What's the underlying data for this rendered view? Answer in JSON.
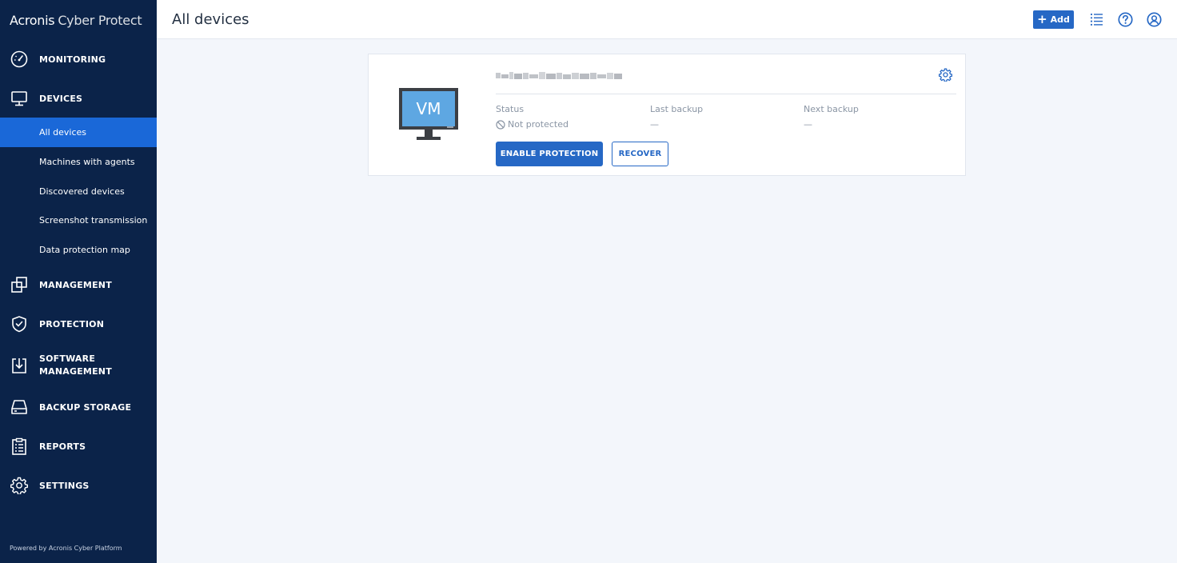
{
  "brand": {
    "part1": "Acronis",
    "part2": "Cyber Protect"
  },
  "sidebar": {
    "items": [
      {
        "label": "MONITORING"
      },
      {
        "label": "DEVICES"
      },
      {
        "label": "MANAGEMENT"
      },
      {
        "label": "PROTECTION"
      },
      {
        "label": "SOFTWARE"
      },
      {
        "label": "MANAGEMENT"
      },
      {
        "label": "BACKUP STORAGE"
      },
      {
        "label": "REPORTS"
      },
      {
        "label": "SETTINGS"
      }
    ],
    "sub_items": [
      {
        "label": "All devices",
        "active": true
      },
      {
        "label": "Machines with agents"
      },
      {
        "label": "Discovered devices"
      },
      {
        "label": "Screenshot transmission"
      },
      {
        "label": "Data protection map"
      }
    ],
    "footer": "Powered by Acronis Cyber Platform"
  },
  "header": {
    "title": "All devices",
    "add_label": "Add",
    "add_icon": "plus-icon",
    "icons": [
      "list-icon",
      "help-icon",
      "account-icon"
    ]
  },
  "device": {
    "vm_label": "VM",
    "status_label": "Status",
    "status_value": "Not protected",
    "last_backup_label": "Last backup",
    "last_backup_value": "—",
    "next_backup_label": "Next backup",
    "next_backup_value": "—",
    "enable_protection_label": "ENABLE PROTECTION",
    "recover_label": "RECOVER"
  },
  "colors": {
    "sidebar_bg": "#0b2349",
    "active_item": "#1a68d8",
    "primary": "#2668c5",
    "page_bg": "#f3f6fb"
  }
}
